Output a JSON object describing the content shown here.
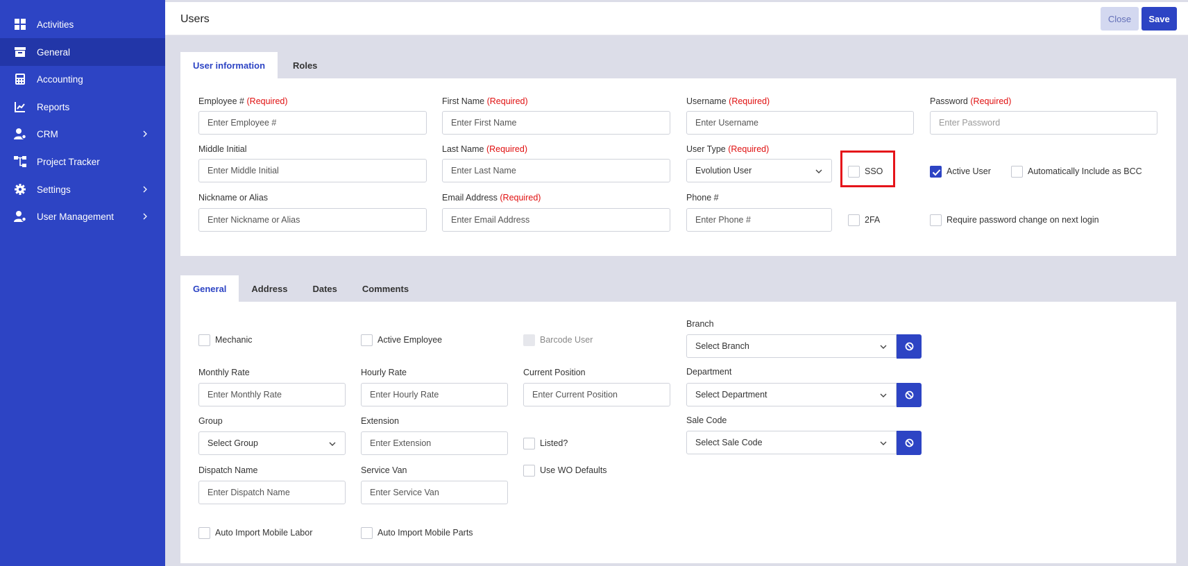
{
  "sidebar": {
    "items": [
      {
        "label": "Activities"
      },
      {
        "label": "General"
      },
      {
        "label": "Accounting"
      },
      {
        "label": "Reports"
      },
      {
        "label": "CRM"
      },
      {
        "label": "Project Tracker"
      },
      {
        "label": "Settings"
      },
      {
        "label": "User Management"
      }
    ]
  },
  "header": {
    "title": "Users",
    "close_label": "Close",
    "save_label": "Save"
  },
  "top_tabs": [
    {
      "label": "User information"
    },
    {
      "label": "Roles"
    }
  ],
  "user_info": {
    "required_text": "(Required)",
    "employee_no": {
      "label": "Employee #",
      "placeholder": "Enter Employee #"
    },
    "first_name": {
      "label": "First Name",
      "placeholder": "Enter First Name"
    },
    "username": {
      "label": "Username",
      "placeholder": "Enter Username"
    },
    "password": {
      "label": "Password",
      "placeholder": "Enter Password"
    },
    "middle_initial": {
      "label": "Middle Initial",
      "placeholder": "Enter Middle Initial"
    },
    "last_name": {
      "label": "Last Name",
      "placeholder": "Enter Last Name"
    },
    "user_type": {
      "label": "User Type",
      "value": "Evolution User"
    },
    "sso": {
      "label": "SSO",
      "checked": false
    },
    "active_user": {
      "label": "Active User",
      "checked": true
    },
    "auto_bcc": {
      "label": "Automatically Include as BCC",
      "checked": false
    },
    "nickname": {
      "label": "Nickname or Alias",
      "placeholder": "Enter Nickname or Alias"
    },
    "email": {
      "label": "Email Address",
      "placeholder": "Enter Email Address"
    },
    "phone": {
      "label": "Phone #",
      "placeholder": "Enter Phone #"
    },
    "twofa": {
      "label": "2FA",
      "checked": false
    },
    "require_pw_change": {
      "label": "Require password change on next login",
      "checked": false
    }
  },
  "bottom_tabs": [
    {
      "label": "General"
    },
    {
      "label": "Address"
    },
    {
      "label": "Dates"
    },
    {
      "label": "Comments"
    }
  ],
  "general": {
    "mechanic": {
      "label": "Mechanic",
      "checked": false
    },
    "active_employee": {
      "label": "Active Employee",
      "checked": false
    },
    "barcode_user": {
      "label": "Barcode User",
      "checked": false,
      "disabled": true
    },
    "branch": {
      "label": "Branch",
      "value": "Select Branch"
    },
    "monthly_rate": {
      "label": "Monthly Rate",
      "placeholder": "Enter Monthly Rate"
    },
    "hourly_rate": {
      "label": "Hourly Rate",
      "placeholder": "Enter Hourly Rate"
    },
    "current_position": {
      "label": "Current Position",
      "placeholder": "Enter Current Position"
    },
    "department": {
      "label": "Department",
      "value": "Select Department"
    },
    "group": {
      "label": "Group",
      "value": "Select Group"
    },
    "extension": {
      "label": "Extension",
      "placeholder": "Enter Extension"
    },
    "listed": {
      "label": "Listed?",
      "checked": false
    },
    "sale_code": {
      "label": "Sale Code",
      "value": "Select Sale Code"
    },
    "dispatch_name": {
      "label": "Dispatch Name",
      "placeholder": "Enter Dispatch Name"
    },
    "service_van": {
      "label": "Service Van",
      "placeholder": "Enter Service Van"
    },
    "use_wo_defaults": {
      "label": "Use WO Defaults",
      "checked": false
    },
    "auto_import_labor": {
      "label": "Auto Import Mobile Labor",
      "checked": false
    },
    "auto_import_parts": {
      "label": "Auto Import Mobile Parts",
      "checked": false
    }
  },
  "colors": {
    "accent": "#2d44c4",
    "sidebar": "#2d44c4",
    "required": "#e01010",
    "highlight": "#e5141a"
  }
}
